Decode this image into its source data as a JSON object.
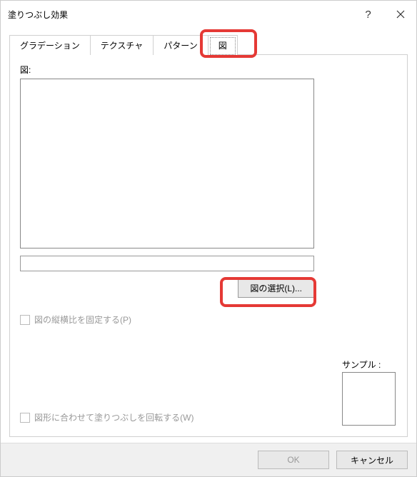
{
  "titlebar": {
    "title": "塗りつぶし効果",
    "help_icon": "?",
    "close_icon": "×"
  },
  "tabs": {
    "gradient": "グラデーション",
    "texture": "テクスチャ",
    "pattern": "パターン",
    "picture": "図"
  },
  "panel": {
    "picture_label": "図:",
    "select_button": "図の選択(L)...",
    "lock_aspect": "図の縦横比を固定する(P)",
    "rotate_with_shape": "図形に合わせて塗りつぶしを回転する(W)",
    "sample_label": "サンプル :"
  },
  "buttons": {
    "ok": "OK",
    "cancel": "キャンセル"
  }
}
